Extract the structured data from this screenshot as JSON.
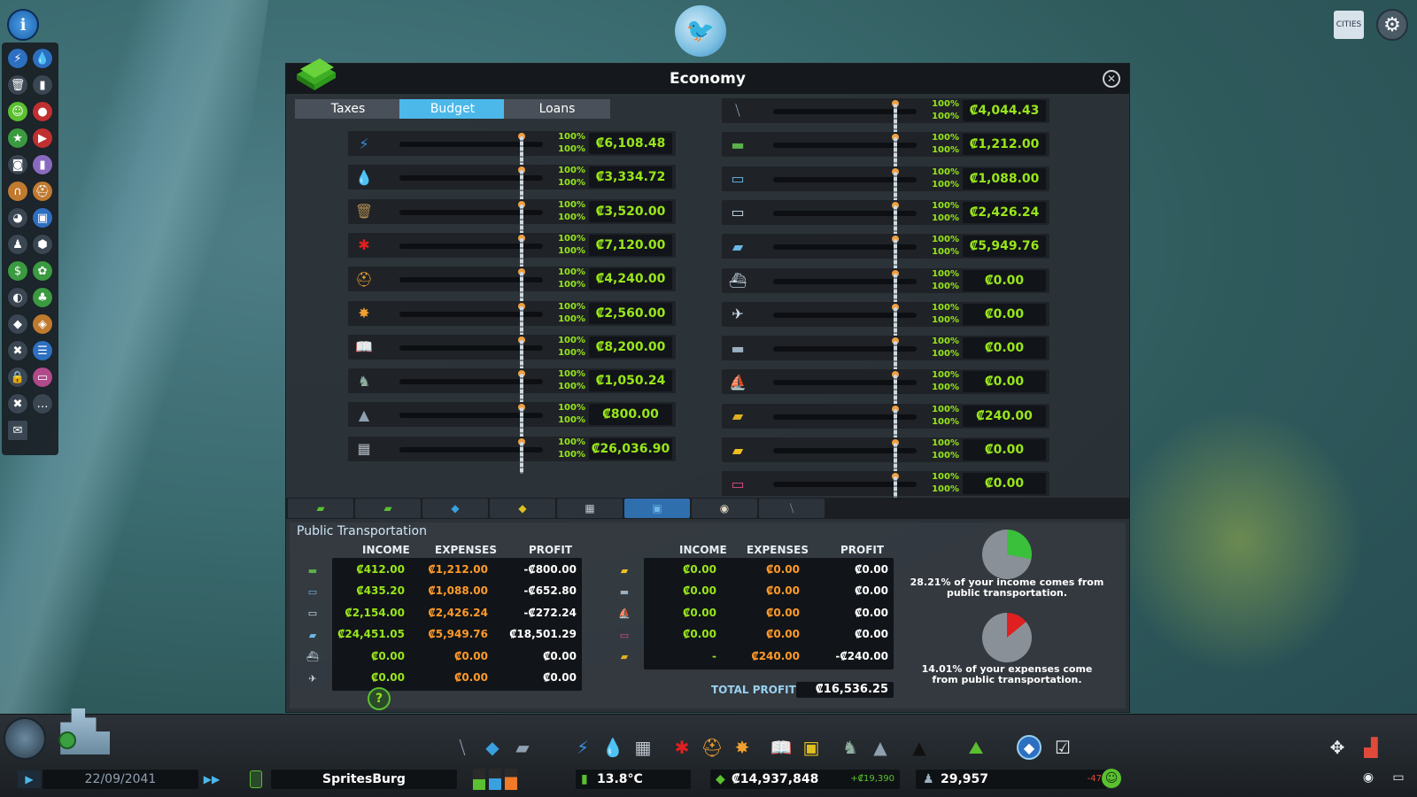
{
  "window": {
    "title": "Economy",
    "close_icon": "close-icon"
  },
  "tabs": [
    {
      "label": "Taxes",
      "active": false
    },
    {
      "label": "Budget",
      "active": true
    },
    {
      "label": "Loans",
      "active": false
    }
  ],
  "budget_left": [
    {
      "icon": "electricity-icon",
      "glyph": "⚡",
      "color": "#3a8fe0",
      "pct1": "100%",
      "pct2": "100%",
      "amount": "₡6,108.48"
    },
    {
      "icon": "water-icon",
      "glyph": "💧",
      "color": "#3a8fe0",
      "pct1": "100%",
      "pct2": "100%",
      "amount": "₡3,334.72"
    },
    {
      "icon": "garbage-icon",
      "glyph": "🗑",
      "color": "#b08a50",
      "pct1": "100%",
      "pct2": "100%",
      "amount": "₡3,520.00"
    },
    {
      "icon": "healthcare-icon",
      "glyph": "✱",
      "color": "#e02020",
      "pct1": "100%",
      "pct2": "100%",
      "amount": "₡7,120.00"
    },
    {
      "icon": "fire-icon",
      "glyph": "⛑",
      "color": "#f0a030",
      "pct1": "100%",
      "pct2": "100%",
      "amount": "₡4,240.00"
    },
    {
      "icon": "police-icon",
      "glyph": "✸",
      "color": "#f0a030",
      "pct1": "100%",
      "pct2": "100%",
      "amount": "₡2,560.00"
    },
    {
      "icon": "education-icon",
      "glyph": "📖",
      "color": "#e8e0c8",
      "pct1": "100%",
      "pct2": "100%",
      "amount": "₡8,200.00"
    },
    {
      "icon": "parks-icon",
      "glyph": "♞",
      "color": "#8fb0a0",
      "pct1": "100%",
      "pct2": "100%",
      "amount": "₡1,050.24"
    },
    {
      "icon": "monument-icon",
      "glyph": "▲",
      "color": "#8fa0b0",
      "pct1": "100%",
      "pct2": "100%",
      "amount": "₡800.00"
    },
    {
      "icon": "industry-icon",
      "glyph": "▦",
      "color": "#b0b8c0",
      "pct1": "100%",
      "pct2": "100%",
      "amount": "₡26,036.90"
    }
  ],
  "budget_right": [
    {
      "icon": "road-icon",
      "glyph": "⧹",
      "color": "#8fa0b0",
      "pct1": "100%",
      "pct2": "100%",
      "amount": "₡4,044.43"
    },
    {
      "icon": "bus-icon",
      "glyph": "▬",
      "color": "#5ab04a",
      "pct1": "100%",
      "pct2": "100%",
      "amount": "₡1,212.00"
    },
    {
      "icon": "tram-icon",
      "glyph": "▭",
      "color": "#6ab8e8",
      "pct1": "100%",
      "pct2": "100%",
      "amount": "₡1,088.00"
    },
    {
      "icon": "metro-icon",
      "glyph": "▭",
      "color": "#cfe0ef",
      "pct1": "100%",
      "pct2": "100%",
      "amount": "₡2,426.24"
    },
    {
      "icon": "train-icon",
      "glyph": "▰",
      "color": "#6ab8e8",
      "pct1": "100%",
      "pct2": "100%",
      "amount": "₡5,949.76"
    },
    {
      "icon": "ship-icon",
      "glyph": "⛴",
      "color": "#cfe0ef",
      "pct1": "100%",
      "pct2": "100%",
      "amount": "₡0.00"
    },
    {
      "icon": "plane-icon",
      "glyph": "✈",
      "color": "#cfe0ef",
      "pct1": "100%",
      "pct2": "100%",
      "amount": "₡0.00"
    },
    {
      "icon": "monorail-icon",
      "glyph": "▬",
      "color": "#9ab0c0",
      "pct1": "100%",
      "pct2": "100%",
      "amount": "₡0.00"
    },
    {
      "icon": "ferry-icon",
      "glyph": "⛵",
      "color": "#9ad0f0",
      "pct1": "100%",
      "pct2": "100%",
      "amount": "₡0.00"
    },
    {
      "icon": "truck-icon",
      "glyph": "▰",
      "color": "#e0b020",
      "pct1": "100%",
      "pct2": "100%",
      "amount": "₡240.00"
    },
    {
      "icon": "taxi-icon",
      "glyph": "▰",
      "color": "#f0c020",
      "pct1": "100%",
      "pct2": "100%",
      "amount": "₡0.00"
    },
    {
      "icon": "cable-car-icon",
      "glyph": "▭",
      "color": "#e04a8a",
      "pct1": "100%",
      "pct2": "100%",
      "amount": "₡0.00"
    }
  ],
  "category_tabs": [
    {
      "icon": "money-icon",
      "glyph": "▰",
      "color": "#5ac030"
    },
    {
      "icon": "money-stack-icon",
      "glyph": "▰",
      "color": "#5ac030"
    },
    {
      "icon": "residential-tax-icon",
      "glyph": "◆",
      "color": "#3aa0e0"
    },
    {
      "icon": "commercial-tax-icon",
      "glyph": "◆",
      "color": "#e0c020"
    },
    {
      "icon": "industry-tab-icon",
      "glyph": "▦",
      "color": "#c0c8d0"
    },
    {
      "icon": "transport-tab-icon",
      "glyph": "▣",
      "color": "#6ab8e8"
    },
    {
      "icon": "loan-tab-icon",
      "glyph": "◉",
      "color": "#e0d8c0"
    },
    {
      "icon": "road-tab-icon",
      "glyph": "⧹",
      "color": "#8fa0b0"
    }
  ],
  "summary": {
    "title": "Public Transportation",
    "headers": [
      "INCOME",
      "EXPENSES",
      "PROFIT"
    ],
    "left_rows": [
      {
        "icon": "bus-icon",
        "glyph": "▬",
        "color": "#5ab04a",
        "income": "₡412.00",
        "expenses": "₡1,212.00",
        "profit": "-₡800.00"
      },
      {
        "icon": "tram-icon",
        "glyph": "▭",
        "color": "#6ab8e8",
        "income": "₡435.20",
        "expenses": "₡1,088.00",
        "profit": "-₡652.80"
      },
      {
        "icon": "metro-icon",
        "glyph": "▭",
        "color": "#cfe0ef",
        "income": "₡2,154.00",
        "expenses": "₡2,426.24",
        "profit": "-₡272.24"
      },
      {
        "icon": "train-icon",
        "glyph": "▰",
        "color": "#6ab8e8",
        "income": "₡24,451.05",
        "expenses": "₡5,949.76",
        "profit": "₡18,501.29"
      },
      {
        "icon": "ship-icon",
        "glyph": "⛴",
        "color": "#cfe0ef",
        "income": "₡0.00",
        "expenses": "₡0.00",
        "profit": "₡0.00"
      },
      {
        "icon": "plane-icon",
        "glyph": "✈",
        "color": "#cfe0ef",
        "income": "₡0.00",
        "expenses": "₡0.00",
        "profit": "₡0.00"
      }
    ],
    "right_rows": [
      {
        "icon": "taxi-icon",
        "glyph": "▰",
        "color": "#f0c020",
        "income": "₡0.00",
        "expenses": "₡0.00",
        "profit": "₡0.00"
      },
      {
        "icon": "monorail-icon",
        "glyph": "▬",
        "color": "#9ab0c0",
        "income": "₡0.00",
        "expenses": "₡0.00",
        "profit": "₡0.00"
      },
      {
        "icon": "ferry-icon",
        "glyph": "⛵",
        "color": "#9ad0f0",
        "income": "₡0.00",
        "expenses": "₡0.00",
        "profit": "₡0.00"
      },
      {
        "icon": "cable-car-icon",
        "glyph": "▭",
        "color": "#e04a8a",
        "income": "₡0.00",
        "expenses": "₡0.00",
        "profit": "₡0.00"
      },
      {
        "icon": "truck-icon",
        "glyph": "▰",
        "color": "#e0b020",
        "income": "-",
        "expenses": "₡240.00",
        "profit": "-₡240.00"
      }
    ],
    "total_label": "TOTAL PROFIT",
    "total_value": "₡16,536.25",
    "income_share": 0.2821,
    "expense_share": 0.1401,
    "income_text": "28.21% of your income comes from public transportation.",
    "expense_text": "14.01% of your expenses come from public transportation.",
    "help": "?"
  },
  "bottom": {
    "date": "22/09/2041",
    "city": "SpritesBurg",
    "temperature": "13.8°C",
    "money": "₡14,937,848",
    "money_change": "+₡19,390",
    "population": "29,957",
    "population_change": "-47"
  },
  "colors": {
    "accent": "#4cb8ea",
    "positive": "#98e61a",
    "negative": "#ff9a2a"
  }
}
